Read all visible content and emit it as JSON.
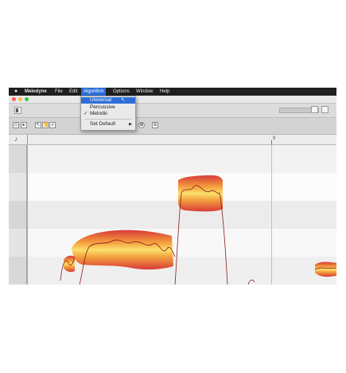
{
  "menubar": {
    "apple": "",
    "items": [
      "Melodyne",
      "File",
      "Edit",
      "Algorithm",
      "Options",
      "Window",
      "Help"
    ]
  },
  "algorithm_menu": {
    "items": [
      {
        "label": "Universal",
        "selected": true,
        "checked": false
      },
      {
        "label": "Percussive",
        "selected": false,
        "checked": false
      },
      {
        "label": "Melodic",
        "selected": false,
        "checked": true
      },
      {
        "label": "Set Default",
        "selected": false,
        "checked": false,
        "submenu": true
      }
    ],
    "check_mark": "✓",
    "submenu_arrow": "▶"
  },
  "ruler": {
    "labels": [
      "9"
    ]
  },
  "colors": {
    "menubar": "#1f1f1f",
    "highlight": "#2d6fd6",
    "blob_core": "#f7c04a",
    "blob_edge": "#d83a3a",
    "pitch_line": "#8a1a1a"
  },
  "icons": {
    "apple": "apple-icon",
    "tuning_fork": "tuning-fork-icon",
    "pointer": "pointer-tool-icon",
    "hand": "hand-tool-icon",
    "zoom": "zoom-tool-icon"
  }
}
